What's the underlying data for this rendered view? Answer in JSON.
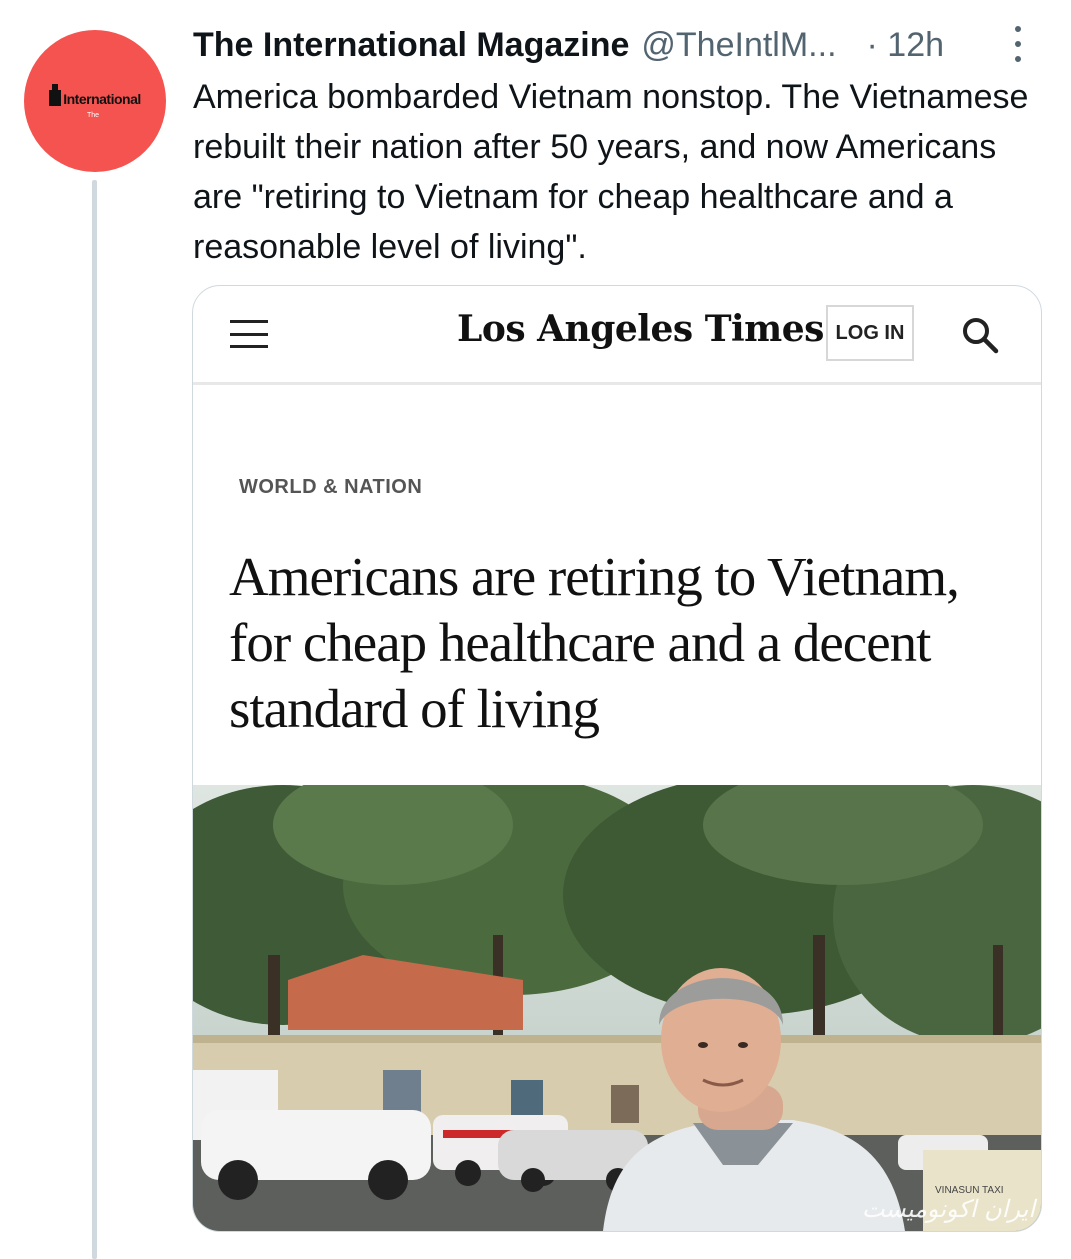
{
  "tweet": {
    "author_name": "The International Magazine",
    "author_handle": "@TheIntlM...",
    "time": "· 12h",
    "text": "America bombarded Vietnam nonstop. The Vietnamese rebuilt their nation after 50 years, and now Americans are \"retiring to Vietnam for cheap healthcare and a reasonable level of living\".",
    "avatar": {
      "logo_text": "International",
      "logo_sup": "The",
      "color": "#f4534f"
    }
  },
  "card": {
    "masthead": "Los Angeles Times",
    "login_label": "LOG IN",
    "section": "WORLD & NATION",
    "headline": "Americans are retiring to Vietnam, for cheap healthcare and a decent standard of living"
  },
  "photo": {
    "sign_text": "VINASUN TAXI",
    "watermark": "ایران اکونومیست"
  },
  "colors": {
    "muted": "#536471",
    "border": "#cfd9de",
    "accent_red": "#f4534f"
  },
  "icons": [
    "more-icon",
    "hamburger-menu-icon",
    "search-icon"
  ]
}
